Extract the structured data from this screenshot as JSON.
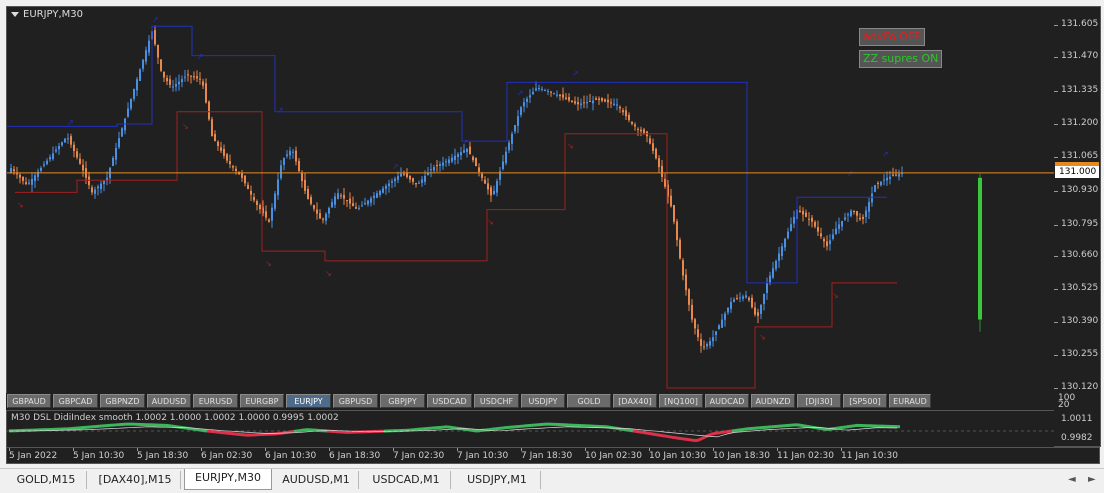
{
  "chart": {
    "title": "EURJPY,M30",
    "status": [
      {
        "label": "advFo OFF",
        "color": "#e02020"
      },
      {
        "label": "ZZ supres ON",
        "color": "#28c828"
      }
    ],
    "current_price": "131.000",
    "price_labels": [
      "131.605",
      "131.470",
      "131.335",
      "131.200",
      "131.065",
      "131.000",
      "130.930",
      "130.795",
      "130.660",
      "130.525",
      "130.390",
      "130.255",
      "130.120"
    ],
    "colors": {
      "background": "#202020",
      "bull": "#4a90e2",
      "bear": "#e8884a",
      "zigzag_high": "#2030c0",
      "zigzag_low": "#a02020",
      "price_line": "#e58a1f",
      "volume_bar": "#3ac83a"
    }
  },
  "symbols": [
    "GBPAUD",
    "GBPCAD",
    "GBPNZD",
    "AUDUSD",
    "EURUSD",
    "EURGBP",
    "EURJPY",
    "GBPUSD",
    "GBPJPY",
    "USDCAD",
    "USDCHF",
    "USDJPY",
    "GOLD",
    "[DAX40]",
    "[NQ100]",
    "AUDCAD",
    "AUDNZD",
    "[DJI30]",
    "[SP500]",
    "EURAUD"
  ],
  "active_symbol": "EURJPY",
  "indicator": {
    "title": "M30 DSL DidiIndex smooth 1.0002 1.0000 1.0002 1.0000 0.9995 1.0002",
    "axis_top": "100",
    "axis_top2": "20",
    "axis_labels": [
      "1.0011",
      "0.9982"
    ],
    "colors": {
      "up": "#3cb85c",
      "down": "#e0304a",
      "line": "#dddddd"
    }
  },
  "time_labels": [
    "5 Jan 2022",
    "5 Jan 10:30",
    "5 Jan 18:30",
    "6 Jan 02:30",
    "6 Jan 10:30",
    "6 Jan 18:30",
    "7 Jan 02:30",
    "7 Jan 10:30",
    "7 Jan 18:30",
    "10 Jan 02:30",
    "10 Jan 10:30",
    "10 Jan 18:30",
    "11 Jan 02:30",
    "11 Jan 10:30"
  ],
  "tabs": [
    "GOLD,M15",
    "[DAX40],M15",
    "EURJPY,M30",
    "AUDUSD,M1",
    "USDCAD,M1",
    "USDJPY,M1"
  ],
  "active_tab": "EURJPY,M30",
  "scroll_arrows": {
    "left": "◄",
    "right": "►"
  }
}
